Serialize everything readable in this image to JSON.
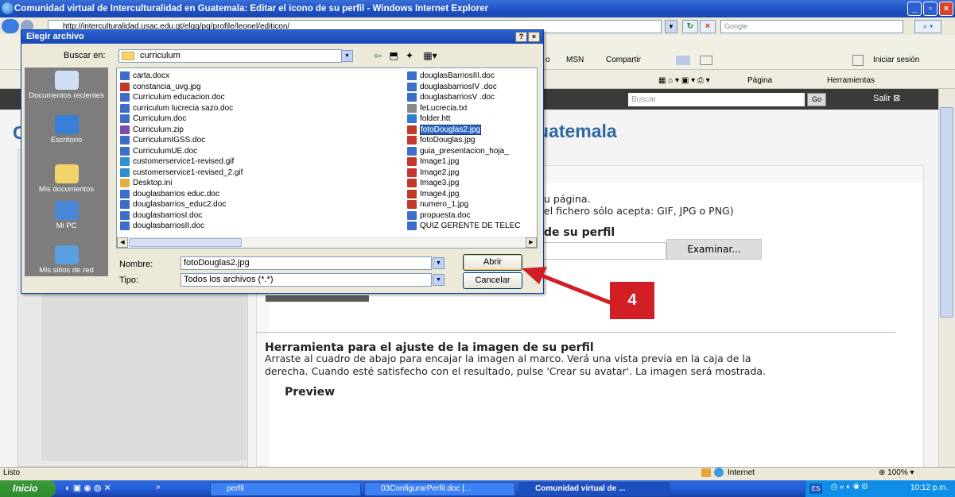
{
  "ie": {
    "title": "Comunidad virtual de Interculturalidad en Guatemala: Editar el icono de su perfil - Windows Internet Explorer",
    "address": "http://interculturalidad.usac.edu.gt/elgg/pg/profile/leonel/editicon/",
    "search_placeholder": "Google",
    "links": [
      "MSN",
      "Compartir",
      "Iniciar sesión"
    ],
    "links_prefix": "o",
    "cmd_items": [
      "Página",
      "Herramientas"
    ]
  },
  "site": {
    "search_placeholder": "Buscar",
    "go": "Go",
    "logout": "Salir",
    "heading_fragment": "uatemala",
    "left_letter": "C",
    "text_line1": "u página.",
    "text_line2": "el fichero sólo acepta: GIF, JPG o PNG)",
    "upload_heading_fragment": "de su perfil",
    "browse_button": "Examinar...",
    "tool_heading": "Herramienta para el ajuste de la imagen de su perfil",
    "tool_text1": "Arraste al cuadro de abajo para encajar la imagen al marco. Verá una vista previa en la caja de la",
    "tool_text2": "derecha. Cuando esté satisfecho con el resultado, pulse 'Crear su avatar'. La imagen será mostrada.",
    "preview_label": "Preview"
  },
  "dialog": {
    "title": "Elegir archivo",
    "look_in_label": "Buscar en:",
    "look_in_value": "curriculum",
    "places": [
      "Documentos recientes",
      "Escritorio",
      "Mis documentos",
      "Mi PC",
      "Mis sitios de red"
    ],
    "files_col1": [
      {
        "name": "carta.docx",
        "type": "doc"
      },
      {
        "name": "constancia_uvg.jpg",
        "type": "img"
      },
      {
        "name": "Curriculum educacion.doc",
        "type": "doc"
      },
      {
        "name": "curriculum lucrecia sazo.doc",
        "type": "doc"
      },
      {
        "name": "Curriculum.doc",
        "type": "doc"
      },
      {
        "name": "Curriculum.zip",
        "type": "zip"
      },
      {
        "name": "CurriculumIGSS.doc",
        "type": "doc"
      },
      {
        "name": "CurriculumUE.doc",
        "type": "doc"
      },
      {
        "name": "customerservice1-revised.gif",
        "type": "gif"
      },
      {
        "name": "customerservice1-revised_2.gif",
        "type": "gif"
      },
      {
        "name": "Desktop.ini",
        "type": "ini"
      },
      {
        "name": "douglasbarrios educ.doc",
        "type": "doc"
      },
      {
        "name": "douglasbarrios_educ2.doc",
        "type": "doc"
      },
      {
        "name": "douglasbarriosI.doc",
        "type": "doc"
      },
      {
        "name": "douglasbarriosII.doc",
        "type": "doc"
      }
    ],
    "files_col2": [
      {
        "name": "douglasBarriosIII.doc",
        "type": "doc"
      },
      {
        "name": "douglasbarriosIV .doc",
        "type": "doc"
      },
      {
        "name": "douglasbarriosV .doc",
        "type": "doc"
      },
      {
        "name": "feLucrecia.txt",
        "type": "txt"
      },
      {
        "name": "folder.htt",
        "type": "htt"
      },
      {
        "name": "fotoDouglas2.jpg",
        "type": "img",
        "selected": true
      },
      {
        "name": "fotoDouglas.jpg",
        "type": "img"
      },
      {
        "name": "guia_presentacion_hoja_",
        "type": "doc"
      },
      {
        "name": "Image1.jpg",
        "type": "img"
      },
      {
        "name": "Image2.jpg",
        "type": "img"
      },
      {
        "name": "Image3.jpg",
        "type": "img"
      },
      {
        "name": "Image4.jpg",
        "type": "img"
      },
      {
        "name": "numero_1.jpg",
        "type": "img"
      },
      {
        "name": "propuesta.doc",
        "type": "doc"
      },
      {
        "name": "QUIZ GERENTE DE TELEC",
        "type": "doc"
      }
    ],
    "name_label": "Nombre:",
    "name_value": "fotoDouglas2.jpg",
    "type_label": "Tipo:",
    "type_value": "Todos los archivos (*.*)",
    "open_button": "Abrir",
    "cancel_button": "Cancelar"
  },
  "annotation": {
    "step": "4",
    "color": "#d21f26"
  },
  "status": {
    "text": "Listo",
    "zone": "Internet",
    "zoom": "100%"
  },
  "taskbar": {
    "start": "Inicio",
    "tasks": [
      "perfil",
      "03ConfigurarPerfil.doc [...",
      "Comunidad virtual de ..."
    ],
    "lang": "ES",
    "time": "10:12 p.m."
  },
  "colors": {
    "xp_blue": "#245edc",
    "selection": "#316ac5",
    "site_heading": "#2f67a3"
  }
}
